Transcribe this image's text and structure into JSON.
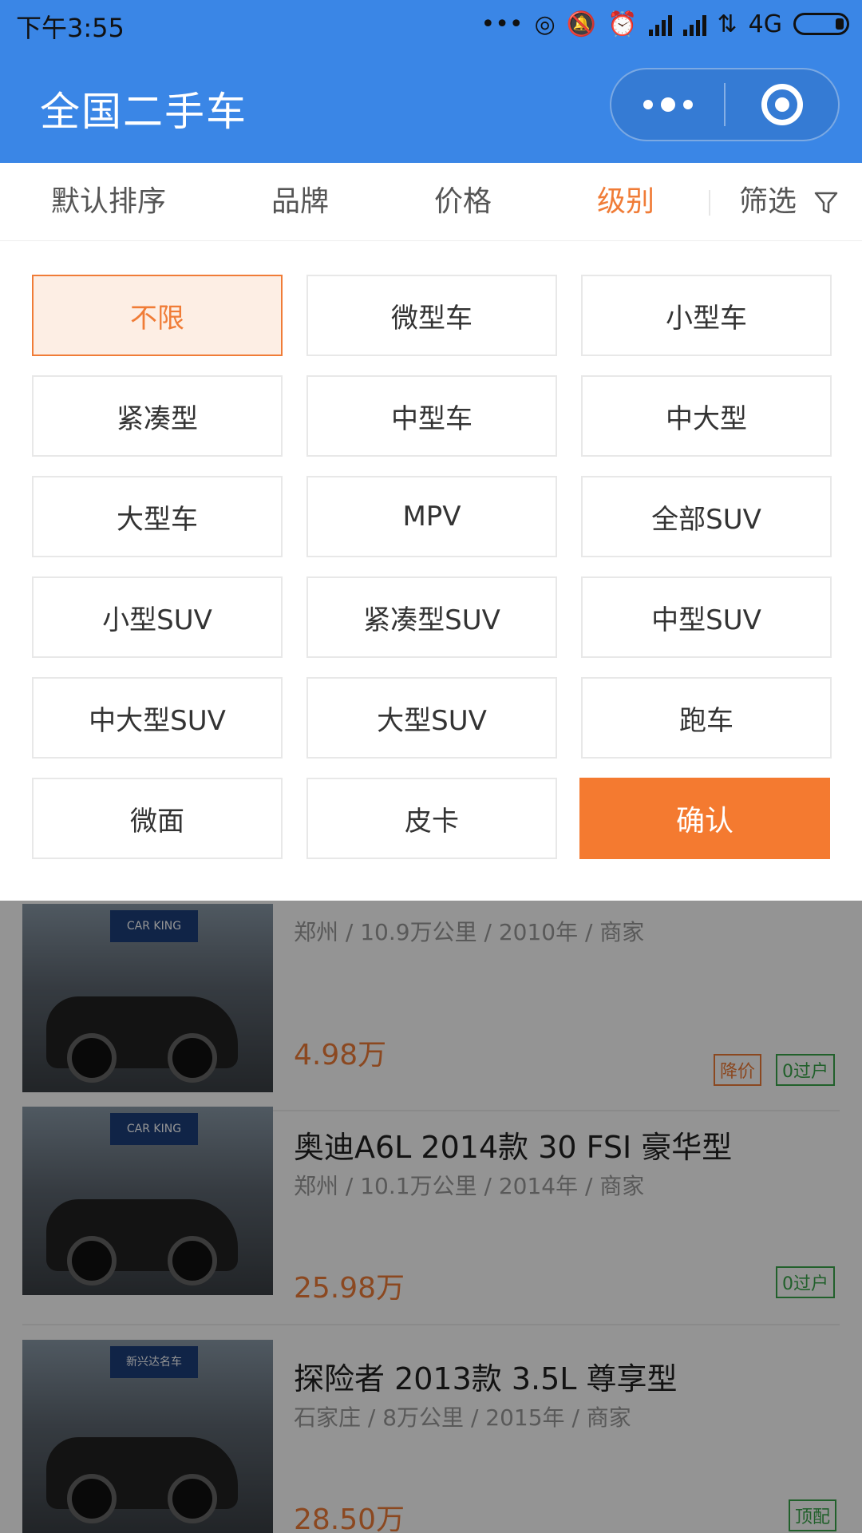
{
  "status_bar": {
    "time": "下午3:55",
    "network": "4G"
  },
  "header": {
    "title": "全国二手车"
  },
  "tabs": [
    {
      "label": "默认排序",
      "active": false
    },
    {
      "label": "品牌",
      "active": false
    },
    {
      "label": "价格",
      "active": false
    },
    {
      "label": "级别",
      "active": true
    },
    {
      "label": "筛选",
      "active": false
    }
  ],
  "level_options": [
    {
      "label": "不限",
      "selected": true
    },
    {
      "label": "微型车"
    },
    {
      "label": "小型车"
    },
    {
      "label": "紧凑型"
    },
    {
      "label": "中型车"
    },
    {
      "label": "中大型"
    },
    {
      "label": "大型车"
    },
    {
      "label": "MPV"
    },
    {
      "label": "全部SUV"
    },
    {
      "label": "小型SUV"
    },
    {
      "label": "紧凑型SUV"
    },
    {
      "label": "中型SUV"
    },
    {
      "label": "中大型SUV"
    },
    {
      "label": "大型SUV"
    },
    {
      "label": "跑车"
    },
    {
      "label": "微面"
    },
    {
      "label": "皮卡"
    }
  ],
  "confirm_label": "确认",
  "listings": [
    {
      "name": "",
      "meta": "郑州 / 10.9万公里 / 2010年 / 商家",
      "price": "4.98万",
      "badges": [
        {
          "text": "降价",
          "color": "orange"
        },
        {
          "text": "0过户",
          "color": "green"
        }
      ],
      "sign": "CAR KING"
    },
    {
      "name": "奥迪A6L 2014款 30 FSI 豪华型",
      "meta": "郑州 / 10.1万公里 / 2014年 / 商家",
      "price": "25.98万",
      "badges": [
        {
          "text": "0过户",
          "color": "green"
        }
      ],
      "sign": "CAR KING"
    },
    {
      "name": "探险者 2013款 3.5L 尊享型",
      "meta": "石家庄 / 8万公里 / 2015年 / 商家",
      "price": "28.50万",
      "badges": [
        {
          "text": "顶配",
          "color": "green"
        }
      ],
      "sign": "新兴达名车"
    }
  ],
  "colors": {
    "brand_blue": "#3a86e6",
    "accent_orange": "#f07c37",
    "confirm_orange": "#f47a30",
    "tag_green": "#3aa64a"
  }
}
